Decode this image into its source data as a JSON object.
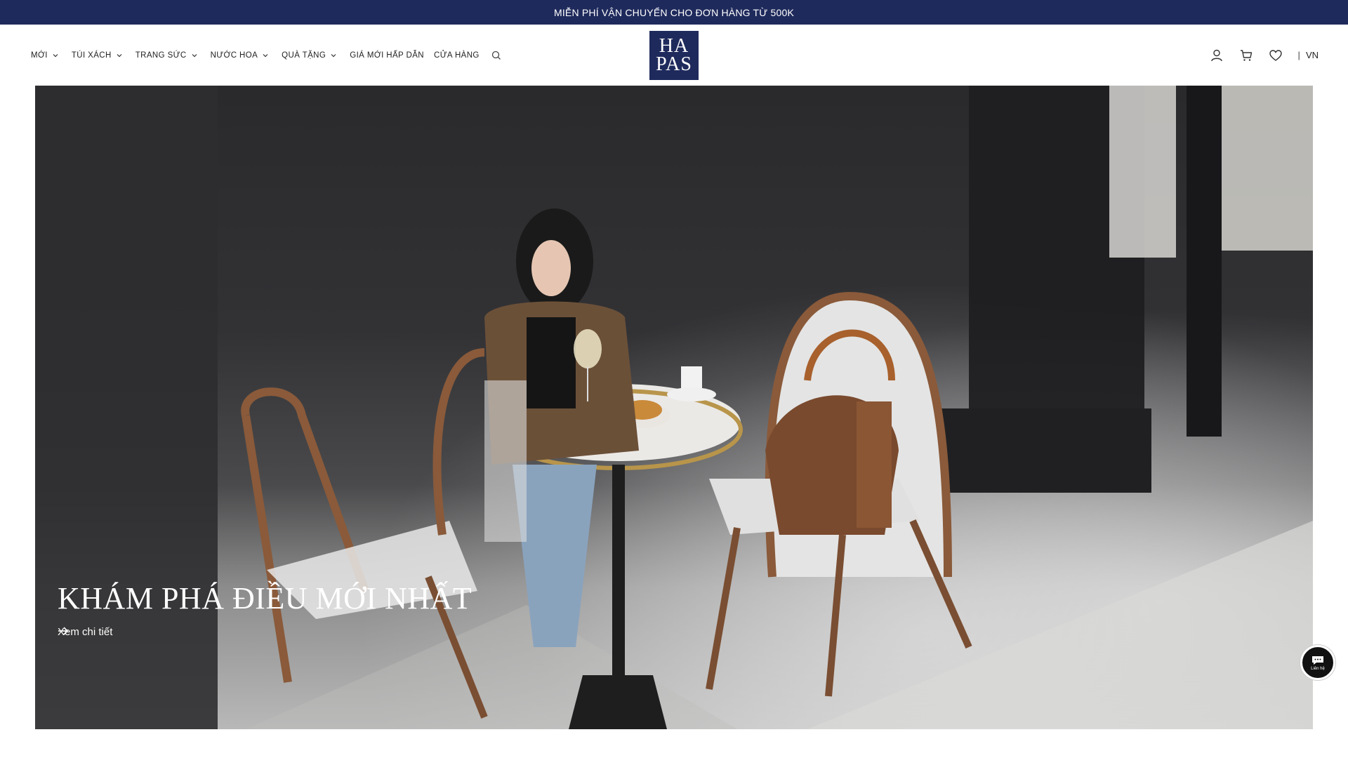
{
  "promo": {
    "text": "MIỄN PHÍ VẬN CHUYỂN CHO ĐƠN HÀNG TỪ 500K"
  },
  "nav": {
    "items": [
      {
        "label": "MỚI",
        "has_dropdown": true
      },
      {
        "label": "TÚI XÁCH",
        "has_dropdown": true
      },
      {
        "label": "TRANG SỨC",
        "has_dropdown": true
      },
      {
        "label": "NƯỚC HOA",
        "has_dropdown": true
      },
      {
        "label": "QUÀ TẶNG",
        "has_dropdown": true
      },
      {
        "label": "GIÁ MỚI HẤP DẪN",
        "has_dropdown": false
      },
      {
        "label": "CỬA HÀNG",
        "has_dropdown": false
      }
    ],
    "search_icon": "search-icon"
  },
  "logo": {
    "line1": "HA",
    "line2": "PAS",
    "brand_color": "#1f2a5c"
  },
  "header_actions": {
    "icons": [
      "user-icon",
      "cart-icon",
      "heart-icon"
    ],
    "separator": "|",
    "language": "VN"
  },
  "hero": {
    "title": "KHÁM PHÁ ĐIỀU MỚI NHẤT",
    "link_label": "Xem chi tiết"
  },
  "chat": {
    "label": "Liên hệ"
  },
  "colors": {
    "promo_bg": "#1f2a5c",
    "text_on_dark": "#ffffff"
  }
}
